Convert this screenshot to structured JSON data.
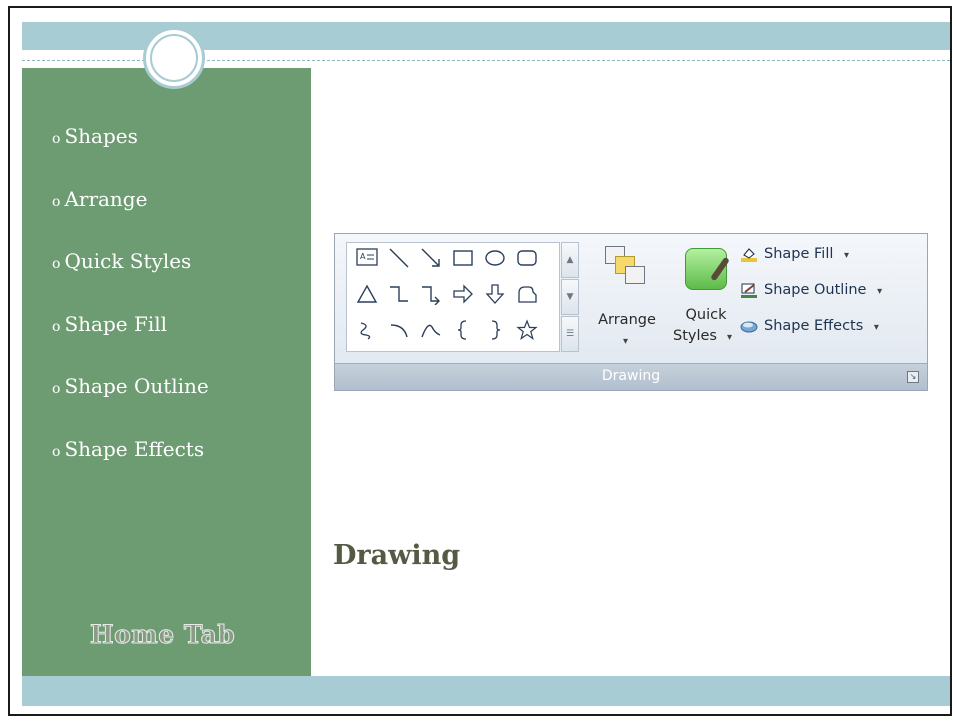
{
  "slide": {
    "bullets": [
      {
        "marker": "o",
        "text": "Shapes"
      },
      {
        "marker": "o",
        "text": "Arrange"
      },
      {
        "marker": "o",
        "text": "Quick Styles"
      },
      {
        "marker": "o",
        "text": "Shape Fill"
      },
      {
        "marker": "o",
        "text": "Shape Outline"
      },
      {
        "marker": "o",
        "text": "Shape Effects"
      }
    ],
    "footer_title": "Home Tab",
    "heading": "Drawing"
  },
  "ribbon": {
    "group_label": "Drawing",
    "arrange_label": "Arrange",
    "quick_label_1": "Quick",
    "quick_label_2": "Styles",
    "shape_fill": "Shape Fill",
    "shape_outline": "Shape Outline",
    "shape_effects": "Shape Effects",
    "shapes": [
      [
        "text-box",
        "line",
        "arrow",
        "rectangle",
        "oval",
        "rounded-rectangle"
      ],
      [
        "triangle",
        "elbow-connector",
        "elbow-arrow-connector",
        "right-arrow",
        "down-arrow",
        "flowchart-shape"
      ],
      [
        "freeform",
        "arc",
        "curve",
        "left-brace",
        "right-brace",
        "star"
      ]
    ]
  },
  "colors": {
    "sidebar": "#6e9c72",
    "bars": "#a8ccd4",
    "heading": "#555a44"
  }
}
